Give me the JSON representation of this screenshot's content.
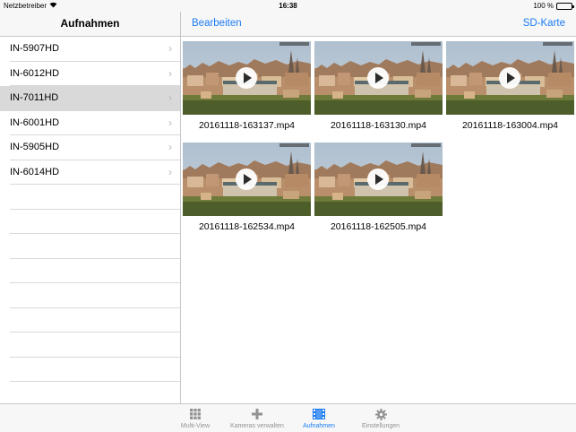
{
  "status": {
    "carrier": "Netzbetreiber",
    "time": "16:38",
    "battery": "100 %"
  },
  "master": {
    "title": "Aufnahmen"
  },
  "detail": {
    "edit_label": "Bearbeiten",
    "sd_label": "SD-Karte"
  },
  "cameras": [
    {
      "label": "IN-5907HD",
      "selected": false
    },
    {
      "label": "IN-6012HD",
      "selected": false
    },
    {
      "label": "IN-7011HD",
      "selected": true
    },
    {
      "label": "IN-6001HD",
      "selected": false
    },
    {
      "label": "IN-5905HD",
      "selected": false
    },
    {
      "label": "IN-6014HD",
      "selected": false
    }
  ],
  "recordings": [
    {
      "filename": "20161118-163137.mp4"
    },
    {
      "filename": "20161118-163130.mp4"
    },
    {
      "filename": "20161118-163004.mp4"
    },
    {
      "filename": "20161118-162534.mp4"
    },
    {
      "filename": "20161118-162505.mp4"
    }
  ],
  "tabs": [
    {
      "label": "Multi-View",
      "icon": "grid-icon",
      "active": false
    },
    {
      "label": "Kameras verwalten",
      "icon": "plus-icon",
      "active": false
    },
    {
      "label": "Aufnahmen",
      "icon": "film-icon",
      "active": true
    },
    {
      "label": "Einstellungen",
      "icon": "gear-icon",
      "active": false
    }
  ],
  "colors": {
    "accent": "#1a7cf5",
    "selected_row": "#d9d9d9",
    "inactive_tab": "#929292"
  }
}
